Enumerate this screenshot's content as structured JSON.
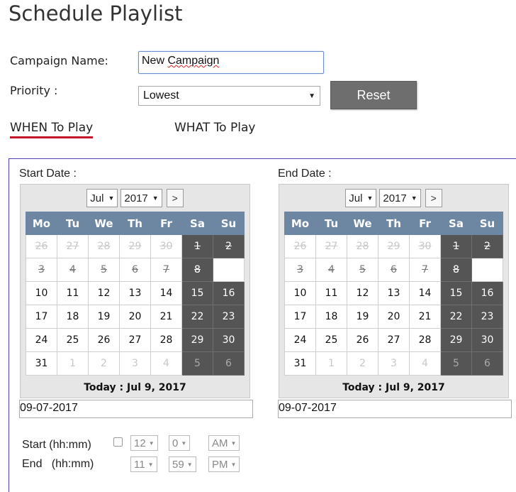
{
  "page": {
    "title": "Schedule Playlist"
  },
  "form": {
    "campaign_label": "Campaign Name:",
    "campaign_value_prefix": "New ",
    "campaign_value_word": "Campaign",
    "priority_label": "Priority :",
    "priority_value": "Lowest",
    "reset_label": "Reset"
  },
  "tabs": {
    "when": "WHEN To Play",
    "what": "WHAT To Play"
  },
  "calendar_common": {
    "weekdays": [
      "Mo",
      "Tu",
      "We",
      "Th",
      "Fr",
      "Sa",
      "Su"
    ],
    "weeks": [
      [
        "26",
        "27",
        "28",
        "29",
        "30",
        "1",
        "2"
      ],
      [
        "3",
        "4",
        "5",
        "6",
        "7",
        "8",
        ""
      ],
      [
        "10",
        "11",
        "12",
        "13",
        "14",
        "15",
        "16"
      ],
      [
        "17",
        "18",
        "19",
        "20",
        "21",
        "22",
        "23"
      ],
      [
        "24",
        "25",
        "26",
        "27",
        "28",
        "29",
        "30"
      ],
      [
        "31",
        "1",
        "2",
        "3",
        "4",
        "5",
        "6"
      ]
    ],
    "next_label": ">"
  },
  "start": {
    "label": "Start Date :",
    "month": "Jul",
    "year": "2017",
    "today_text": "Today : Jul 9, 2017",
    "value": "09-07-2017"
  },
  "end": {
    "label": "End Date :",
    "month": "Jul",
    "year": "2017",
    "today_text": "Today : Jul 9, 2017",
    "value": "09-07-2017"
  },
  "time": {
    "start_label": "Start (hh:mm)",
    "end_label": "End   (hh:mm)",
    "start_hour": "12",
    "start_minute": "0",
    "start_ampm": "AM",
    "end_hour": "11",
    "end_minute": "59",
    "end_ampm": "PM"
  },
  "icons": {
    "dropdown": "chevron-down-icon"
  },
  "colors": {
    "accent_underline": "#c3122a",
    "panel_border": "#4f3fb0",
    "calendar_header": "#6d87a3",
    "weekend_cell": "#555555",
    "reset_button": "#6e6e6e"
  }
}
